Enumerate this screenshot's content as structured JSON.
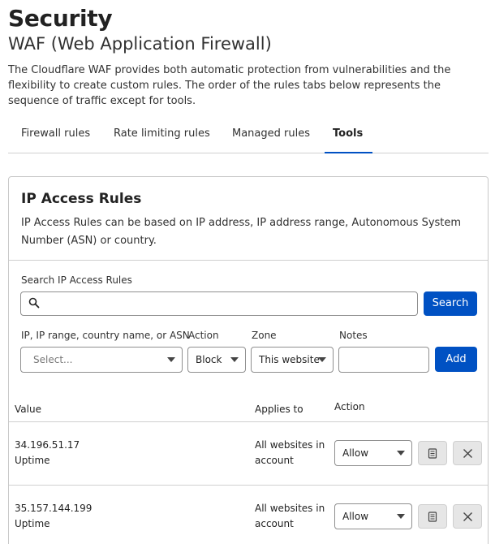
{
  "header": {
    "title": "Security",
    "subtitle": "WAF (Web Application Firewall)",
    "description": "The Cloudflare WAF provides both automatic protection from vulnerabilities and the flexibility to create custom rules. The order of the rules tabs below represents the sequence of traffic except for tools."
  },
  "tabs": [
    {
      "label": "Firewall rules",
      "active": false
    },
    {
      "label": "Rate limiting rules",
      "active": false
    },
    {
      "label": "Managed rules",
      "active": false
    },
    {
      "label": "Tools",
      "active": true
    }
  ],
  "card": {
    "title": "IP Access Rules",
    "description": "IP Access Rules can be based on IP address, IP address range, Autonomous System Number (ASN) or country."
  },
  "search": {
    "label": "Search IP Access Rules",
    "value": "",
    "placeholder": "",
    "button_label": "Search"
  },
  "add_form": {
    "target_label": "IP, IP range, country name, or ASN",
    "target_placeholder": "Select...",
    "action_label": "Action",
    "action_value": "Block",
    "zone_label": "Zone",
    "zone_value": "This website",
    "notes_label": "Notes",
    "notes_value": "",
    "add_button_label": "Add"
  },
  "table": {
    "columns": {
      "value": "Value",
      "applies_to": "Applies to",
      "action": "Action"
    },
    "rows": [
      {
        "value": "34.196.51.17",
        "note": "Uptime",
        "applies_to_line1": "All websites in",
        "applies_to_line2": "account",
        "action": "Allow"
      },
      {
        "value": "35.157.144.199",
        "note": "Uptime",
        "applies_to_line1": "All websites in",
        "applies_to_line2": "account",
        "action": "Allow"
      }
    ]
  },
  "colors": {
    "accent": "#0051c3",
    "border": "#cfcfcf"
  }
}
